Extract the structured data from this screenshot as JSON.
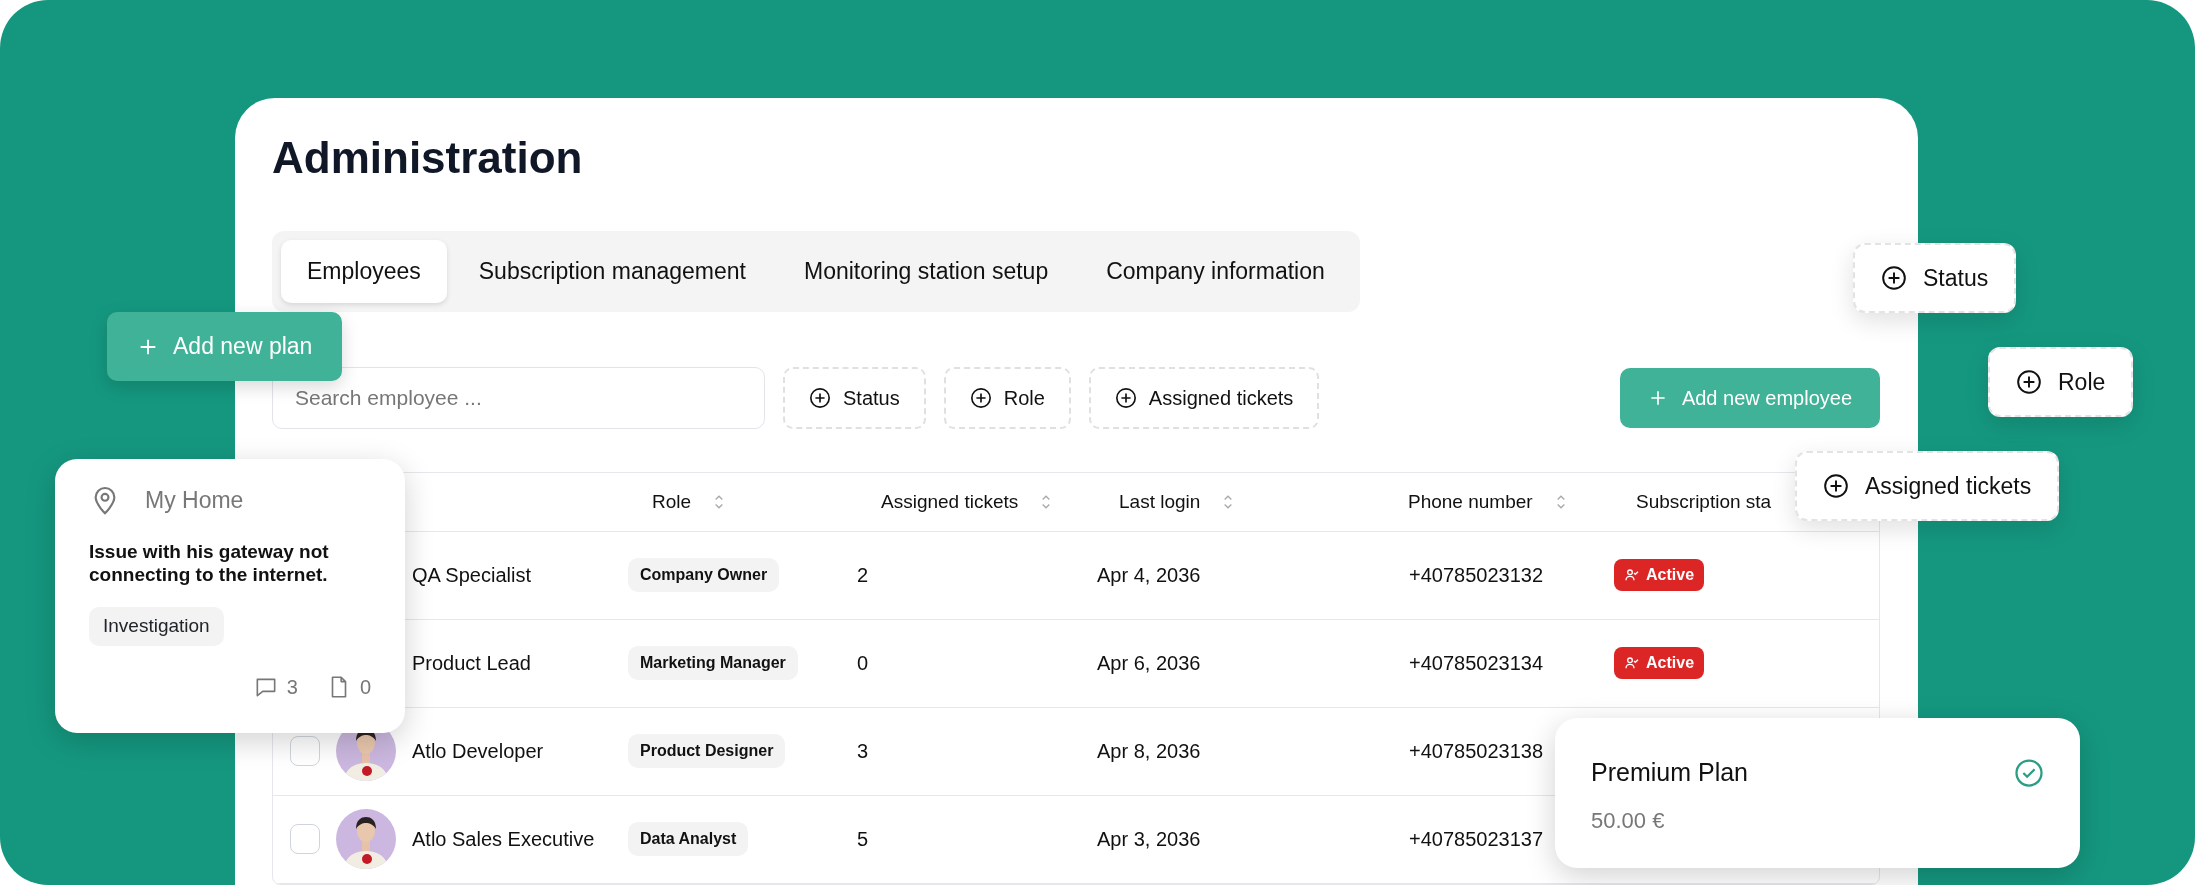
{
  "page": {
    "title": "Administration"
  },
  "tabs": [
    {
      "label": "Employees",
      "selected": true
    },
    {
      "label": "Subscription management",
      "selected": false
    },
    {
      "label": "Monitoring station setup",
      "selected": false
    },
    {
      "label": "Company information",
      "selected": false
    }
  ],
  "toolbar": {
    "search": {
      "placeholder": "Search employee ..."
    },
    "filters": [
      {
        "label": "Status"
      },
      {
        "label": "Role"
      },
      {
        "label": "Assigned tickets"
      }
    ],
    "add_button": {
      "label": "Add new employee"
    }
  },
  "table": {
    "columns": [
      {
        "label": "Role",
        "sortable": true
      },
      {
        "label": "Assigned tickets",
        "sortable": true
      },
      {
        "label": "Last login",
        "sortable": true
      },
      {
        "label": "Phone number",
        "sortable": true
      },
      {
        "label": "Subscription sta",
        "sortable": false
      }
    ],
    "rows": [
      {
        "name": "QA Specialist",
        "role": "Company Owner",
        "tickets": "2",
        "last_login": "Apr 4, 2036",
        "phone": "+40785023132",
        "status": "Active"
      },
      {
        "name": "Product Lead",
        "role": "Marketing Manager",
        "tickets": "0",
        "last_login": "Apr 6, 2036",
        "phone": "+40785023134",
        "status": "Active"
      },
      {
        "name": "Atlo Developer",
        "role": "Product Designer",
        "tickets": "3",
        "last_login": "Apr 8, 2036",
        "phone": "+40785023138",
        "checked": false
      },
      {
        "name": "Atlo Sales Executive",
        "role": "Data Analyst",
        "tickets": "5",
        "last_login": "Apr 3, 2036",
        "phone": "+40785023137",
        "checked": false
      }
    ]
  },
  "floating": {
    "add_plan_button": {
      "label": "Add new plan"
    },
    "filter_chips": [
      {
        "label": "Status"
      },
      {
        "label": "Role"
      },
      {
        "label": "Assigned tickets"
      }
    ],
    "ticket_card": {
      "location": "My Home",
      "description": "Issue with his gateway not connecting to the internet.",
      "tag": "Investigation",
      "comments": "3",
      "files": "0"
    },
    "plan_card": {
      "name": "Premium Plan",
      "price": "50.00 €",
      "selected": true
    }
  }
}
